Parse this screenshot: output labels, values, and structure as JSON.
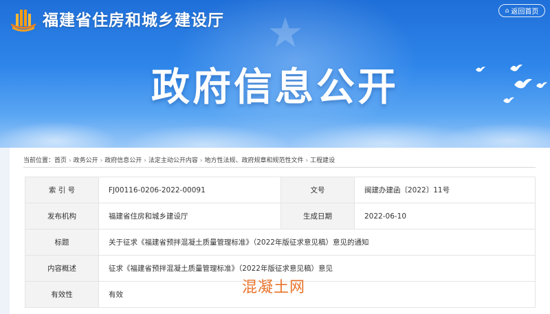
{
  "header": {
    "site_title": "福建省住房和城乡建设厅",
    "back_home_label": "返回首页",
    "headline": "政府信息公开"
  },
  "breadcrumb": {
    "prefix": "当前位置：",
    "items": [
      "首页",
      "政务公开",
      "政府信息公开",
      "法定主动公开内容",
      "地方性法规、政府规章和规范性文件",
      "工程建设"
    ],
    "separator": "›"
  },
  "info_table": {
    "index_label": "索 引 号",
    "index_value": "FJ00116-0206-2022-00091",
    "doc_no_label": "文号",
    "doc_no_value": "闽建办建函〔2022〕11号",
    "publisher_label": "发布机构",
    "publisher_value": "福建省住房和城乡建设厅",
    "date_label": "生成日期",
    "date_value": "2022-06-10",
    "title_label": "标题",
    "title_value": "关于征求《福建省预拌混凝土质量管理标准》（2022年版征求意见稿）意见的通知",
    "summary_label": "内容概述",
    "summary_value": "征求《福建省预拌混凝土质量管理标准》（2022年版征求意见稿）意见",
    "validity_label": "有效性",
    "validity_value": "有效"
  },
  "watermark": "混凝土网",
  "colors": {
    "banner_top": "#1f6fd8",
    "banner_bottom": "#9cc9f8",
    "label_bg": "#f3f3f3",
    "watermark": "#e8742c"
  }
}
